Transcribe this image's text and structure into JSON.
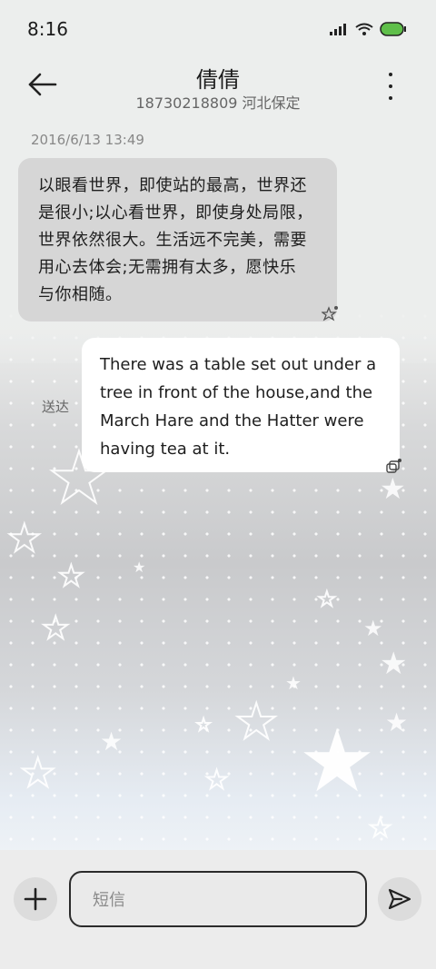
{
  "status_bar": {
    "time": "8:16",
    "battery": "100"
  },
  "header": {
    "contact_name": "倩倩",
    "contact_sub": "18730218809 河北保定"
  },
  "conversation": {
    "timestamp": "2016/6/13 13:49",
    "messages": [
      {
        "direction": "incoming",
        "lines": [
          "以眼看世界，即使站的最高，世界还",
          "是很小;以心看世界，即使身处局限，",
          "世界依然很大。生活远不完美，需要",
          "用心去体会;无需拥有太多，愿快乐",
          "与你相随。"
        ]
      },
      {
        "direction": "outgoing",
        "status": "送达",
        "lines": [
          "There was a table set out under a",
          "tree in front of the house,and the",
          "March Hare and the Hatter were",
          "having tea at it."
        ]
      }
    ]
  },
  "composer": {
    "placeholder": "短信",
    "value": ""
  },
  "colors": {
    "incoming_bubble": "#d6d6d6",
    "outgoing_bubble": "#ffffff",
    "background": "#eceeed"
  }
}
